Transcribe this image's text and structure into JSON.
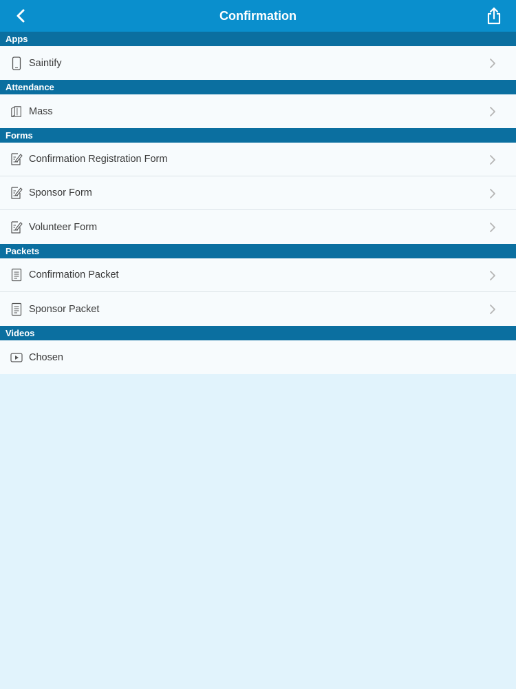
{
  "header": {
    "title": "Confirmation",
    "back_icon": "chevron-left-icon",
    "share_icon": "share-icon",
    "bar_color": "#0a8fcd"
  },
  "sections": [
    {
      "title": "Apps",
      "items": [
        {
          "label": "Saintify",
          "icon": "phone-icon",
          "chevron": true
        }
      ]
    },
    {
      "title": "Attendance",
      "items": [
        {
          "label": "Mass",
          "icon": "book-icon",
          "chevron": true
        }
      ]
    },
    {
      "title": "Forms",
      "items": [
        {
          "label": "Confirmation Registration Form",
          "icon": "form-edit-icon",
          "chevron": true
        },
        {
          "label": "Sponsor Form",
          "icon": "form-edit-icon",
          "chevron": true
        },
        {
          "label": "Volunteer Form",
          "icon": "form-edit-icon",
          "chevron": true
        }
      ]
    },
    {
      "title": "Packets",
      "items": [
        {
          "label": "Confirmation Packet",
          "icon": "document-icon",
          "chevron": true
        },
        {
          "label": "Sponsor Packet",
          "icon": "document-icon",
          "chevron": true
        }
      ]
    },
    {
      "title": "Videos",
      "items": [
        {
          "label": "Chosen",
          "icon": "video-play-icon",
          "chevron": false
        }
      ]
    }
  ],
  "colors": {
    "section_header": "#0b6fa0",
    "row_background": "#f7fbfd",
    "page_background": "#e1f3fc"
  }
}
